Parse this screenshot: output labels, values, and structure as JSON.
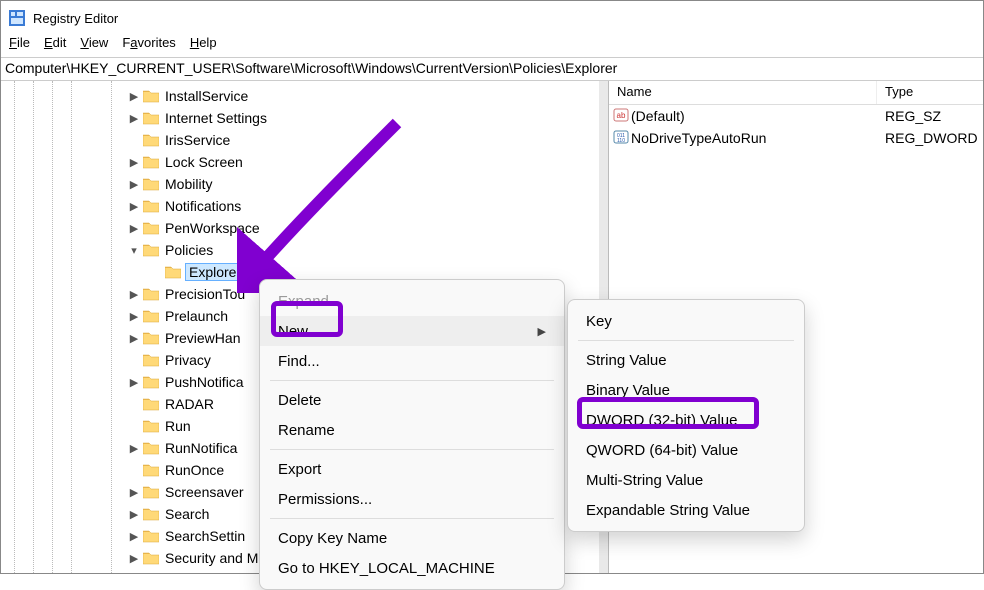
{
  "window": {
    "title": "Registry Editor"
  },
  "menubar": {
    "file": "File",
    "edit": "Edit",
    "view": "View",
    "favorites": "Favorites",
    "help": "Help"
  },
  "address": "Computer\\HKEY_CURRENT_USER\\Software\\Microsoft\\Windows\\CurrentVersion\\Policies\\Explorer",
  "tree": {
    "items": [
      {
        "indent": 126,
        "expander": "▶",
        "label": "InstallService"
      },
      {
        "indent": 126,
        "expander": "▶",
        "label": "Internet Settings"
      },
      {
        "indent": 126,
        "expander": "",
        "label": "IrisService"
      },
      {
        "indent": 126,
        "expander": "▶",
        "label": "Lock Screen"
      },
      {
        "indent": 126,
        "expander": "▶",
        "label": "Mobility"
      },
      {
        "indent": 126,
        "expander": "▶",
        "label": "Notifications"
      },
      {
        "indent": 126,
        "expander": "▶",
        "label": "PenWorkspace"
      },
      {
        "indent": 126,
        "expander": "▾",
        "label": "Policies"
      },
      {
        "indent": 148,
        "expander": "",
        "label": "Explorer",
        "selected": true
      },
      {
        "indent": 126,
        "expander": "▶",
        "label": "PrecisionTou"
      },
      {
        "indent": 126,
        "expander": "▶",
        "label": "Prelaunch"
      },
      {
        "indent": 126,
        "expander": "▶",
        "label": "PreviewHan"
      },
      {
        "indent": 126,
        "expander": "",
        "label": "Privacy"
      },
      {
        "indent": 126,
        "expander": "▶",
        "label": "PushNotifica"
      },
      {
        "indent": 126,
        "expander": "",
        "label": "RADAR"
      },
      {
        "indent": 126,
        "expander": "",
        "label": "Run"
      },
      {
        "indent": 126,
        "expander": "▶",
        "label": "RunNotifica"
      },
      {
        "indent": 126,
        "expander": "",
        "label": "RunOnce"
      },
      {
        "indent": 126,
        "expander": "▶",
        "label": "Screensaver"
      },
      {
        "indent": 126,
        "expander": "▶",
        "label": "Search"
      },
      {
        "indent": 126,
        "expander": "▶",
        "label": "SearchSettin"
      },
      {
        "indent": 126,
        "expander": "▶",
        "label": "Security and Maintenance"
      }
    ]
  },
  "values": {
    "header": {
      "name": "Name",
      "type": "Type"
    },
    "rows": [
      {
        "icon": "string",
        "name": "(Default)",
        "type": "REG_SZ"
      },
      {
        "icon": "dword",
        "name": "NoDriveTypeAutoRun",
        "type": "REG_DWORD"
      }
    ]
  },
  "contextMenu": {
    "expand": "Expand",
    "new": "New",
    "find": "Find...",
    "delete": "Delete",
    "rename": "Rename",
    "export": "Export",
    "permissions": "Permissions...",
    "copyKeyName": "Copy Key Name",
    "goToHKLM": "Go to HKEY_LOCAL_MACHINE"
  },
  "newSubmenu": {
    "key": "Key",
    "string": "String Value",
    "binary": "Binary Value",
    "dword": "DWORD (32-bit) Value",
    "qword": "QWORD (64-bit) Value",
    "multi": "Multi-String Value",
    "expand": "Expandable String Value"
  }
}
